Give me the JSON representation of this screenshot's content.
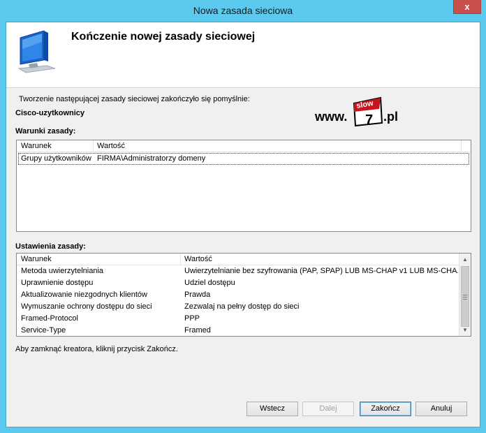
{
  "window": {
    "title": "Nowa zasada sieciowa",
    "close_glyph": "x"
  },
  "header": {
    "title": "Kończenie nowej zasady sieciowej",
    "icon": "monitor-icon"
  },
  "intro_text": "Tworzenie następującej zasady sieciowej zakończyło się pomyślnie:",
  "policy_name": "Cisco-uzytkownicy",
  "logo": {
    "prefix": "www.",
    "badge_top": "slow",
    "badge_number": "7",
    "suffix": ".pl"
  },
  "conditions": {
    "label": "Warunki zasady:",
    "columns": [
      "Warunek",
      "Wartość"
    ],
    "rows": [
      [
        "Grupy użytkowników",
        "FIRMA\\Administratorzy domeny"
      ]
    ]
  },
  "settings": {
    "label": "Ustawienia zasady:",
    "columns": [
      "Warunek",
      "Wartość"
    ],
    "rows": [
      [
        "Metoda uwierzytelniania",
        "Uwierzytelnianie bez szyfrowania (PAP, SPAP) LUB MS-CHAP v1 LUB MS-CHA..."
      ],
      [
        "Uprawnienie dostępu",
        "Udziel dostępu"
      ],
      [
        "Aktualizowanie niezgodnych klientów",
        "Prawda"
      ],
      [
        "Wymuszanie ochrony dostępu do sieci",
        "Zezwalaj na pełny dostęp do sieci"
      ],
      [
        "Framed-Protocol",
        "PPP"
      ],
      [
        "Service-Type",
        "Framed"
      ]
    ]
  },
  "footer_text": "Aby zamknąć kreatora, kliknij przycisk Zakończ.",
  "buttons": {
    "back": "Wstecz",
    "next": "Dalej",
    "finish": "Zakończ",
    "cancel": "Anuluj"
  },
  "colors": {
    "title_bar": "#5cc9ef",
    "close_button": "#c7504b",
    "dialog_background": "#f0f0f0"
  }
}
